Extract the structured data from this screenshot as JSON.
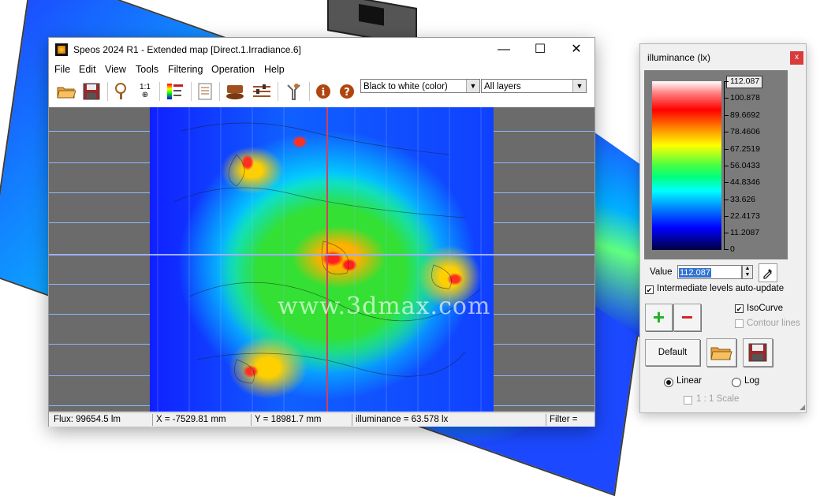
{
  "window": {
    "title": "Speos 2024 R1 - Extended map [Direct.1.Irradiance.6]",
    "minimize_glyph": "—",
    "maximize_glyph": "☐",
    "close_glyph": "✕"
  },
  "menu": [
    {
      "label": "File"
    },
    {
      "label": "Edit"
    },
    {
      "label": "View"
    },
    {
      "label": "Tools"
    },
    {
      "label": "Filtering"
    },
    {
      "label": "Operation"
    },
    {
      "label": "Help"
    }
  ],
  "toolbar": {
    "icons": [
      "open-folder-icon",
      "save-icon",
      "zoom-icon",
      "scale-1-1-icon",
      "max-colorbar-icon",
      "report-icon",
      "layer-icon",
      "settings-lines-icon",
      "tools-icon",
      "info-icon",
      "help-icon"
    ],
    "scale_label": "1:1",
    "palette_select": "Black to white (color)",
    "layer_select": "All layers"
  },
  "map": {
    "watermark": "www.3dmax.com"
  },
  "status": {
    "flux": "Flux: 99654.5 lm",
    "x": "X = -7529.81 mm",
    "y": "Y = 18981.7 mm",
    "illuminance": "illuminance = 63.578 lx",
    "filter": "Filter ="
  },
  "legend_panel": {
    "title": "illuminance (lx)",
    "close_glyph": "x",
    "scale_values": [
      "112.087",
      "100.878",
      "89.6692",
      "78.4606",
      "67.2519",
      "56.0433",
      "44.8346",
      "33.626",
      "22.4173",
      "11.2087",
      "0"
    ],
    "value_label": "Value",
    "value": "112.087",
    "intermediate_label": "Intermediate levels auto-update",
    "intermediate_checked": true,
    "add_glyph": "+",
    "remove_glyph": "−",
    "isocurve_label": "IsoCurve",
    "isocurve_checked": true,
    "contour_label": "Contour lines",
    "contour_checked": false,
    "default_label": "Default",
    "linear_label": "Linear",
    "log_label": "Log",
    "scale_label": "1 : 1 Scale",
    "mode": "Linear",
    "colors": {
      "add": "#20b020",
      "remove": "#d02020",
      "close": "#d93a3a"
    }
  }
}
